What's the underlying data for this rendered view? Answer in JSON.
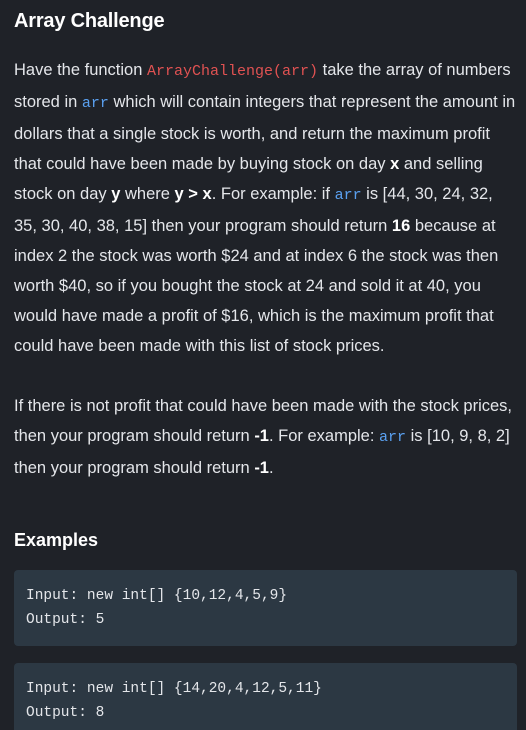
{
  "title": "Array Challenge",
  "paragraph1": {
    "t1": "Have the function ",
    "fn": "ArrayChallenge(arr)",
    "t2": " take the array of numbers stored in ",
    "arr1": "arr",
    "t3": " which will contain integers that represent the amount in dollars that a single stock is worth, and return the maximum profit that could have been made by buying stock on day ",
    "x": "x",
    "t4": " and selling stock on day ",
    "y": "y",
    "t5": " where ",
    "ygx": "y > x",
    "t6": ". For example: if ",
    "arr2": "arr",
    "t7": " is [44, 30, 24, 32, 35, 30, 40, 38, 15] then your program should return ",
    "n16": "16",
    "t8": " because at index 2 the stock was worth $24 and at index 6 the stock was then worth $40, so if you bought the stock at 24 and sold it at 40, you would have made a profit of $16, which is the maximum profit that could have been made with this list of stock prices."
  },
  "paragraph2": {
    "t1": "If there is not profit that could have been made with the stock prices, then your program should return ",
    "neg1a": "-1",
    "t2": ". For example: ",
    "arr": "arr",
    "t3": " is [10, 9, 8, 2] then your program should return ",
    "neg1b": "-1",
    "t4": "."
  },
  "examples_title": "Examples",
  "examples": [
    {
      "input": "Input: new int[] {10,12,4,5,9}",
      "output": "Output: 5"
    },
    {
      "input": "Input: new int[] {14,20,4,12,5,11}",
      "output": "Output: 8"
    }
  ],
  "colors": {
    "background": "#1f2228",
    "code_block": "#2c3843",
    "function_name": "#e05252",
    "variable": "#5aa0f0"
  }
}
